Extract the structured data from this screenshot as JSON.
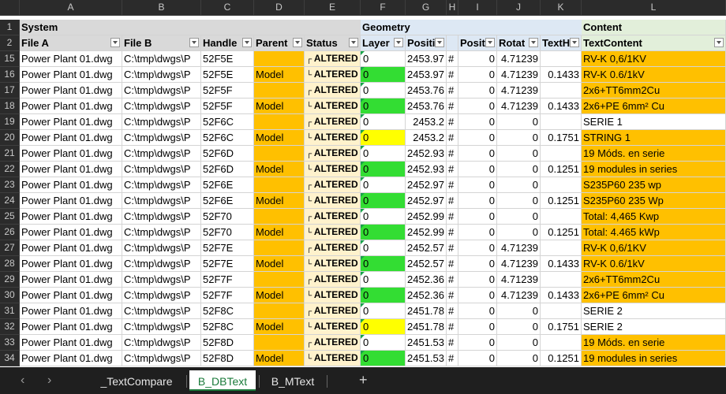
{
  "columns": [
    "A",
    "B",
    "C",
    "D",
    "E",
    "F",
    "G",
    "H",
    "I",
    "J",
    "K",
    "L"
  ],
  "groups": {
    "system": "System",
    "geometry": "Geometry",
    "content": "Content"
  },
  "headers": {
    "file_a": "File A",
    "file_b": "File B",
    "handle": "Handle",
    "parent": "Parent",
    "status": "Status",
    "layer": "Layer",
    "position": "Positi",
    "pos_h": "",
    "pos2": "Posit",
    "rotation": "Rotat",
    "text_height": "TextH",
    "text_content": "TextContent"
  },
  "row_numbers": [
    "1",
    "2"
  ],
  "rows": [
    {
      "n": "15",
      "file_a": "Power Plant 01.dwg",
      "file_b": "C:\\tmp\\dwgs\\P",
      "handle": "52F5E",
      "parent": "",
      "status": "ALTERED",
      "layer": "0",
      "pos": "2453.97",
      "h": "#",
      "pos2": "0",
      "rot": "4.71239",
      "th": "",
      "text": "RV-K 0,6/1KV"
    },
    {
      "n": "16",
      "file_a": "Power Plant 01.dwg",
      "file_b": "C:\\tmp\\dwgs\\P",
      "handle": "52F5E",
      "parent": "Model",
      "status": "ALTERED",
      "layer": "0",
      "pos": "2453.97",
      "h": "#",
      "pos2": "0",
      "rot": "4.71239",
      "th": "0.1433",
      "text": "RV-K 0.6/1kV"
    },
    {
      "n": "17",
      "file_a": "Power Plant 01.dwg",
      "file_b": "C:\\tmp\\dwgs\\P",
      "handle": "52F5F",
      "parent": "",
      "status": "ALTERED",
      "layer": "0",
      "pos": "2453.76",
      "h": "#",
      "pos2": "0",
      "rot": "4.71239",
      "th": "",
      "text": "2x6+TT6mm2Cu"
    },
    {
      "n": "18",
      "file_a": "Power Plant 01.dwg",
      "file_b": "C:\\tmp\\dwgs\\P",
      "handle": "52F5F",
      "parent": "Model",
      "status": "ALTERED",
      "layer": "0",
      "pos": "2453.76",
      "h": "#",
      "pos2": "0",
      "rot": "4.71239",
      "th": "0.1433",
      "text": "2x6+PE 6mm² Cu"
    },
    {
      "n": "19",
      "file_a": "Power Plant 01.dwg",
      "file_b": "C:\\tmp\\dwgs\\P",
      "handle": "52F6C",
      "parent": "",
      "status": "ALTERED",
      "layer": "0",
      "pos": "2453.2",
      "h": "#",
      "pos2": "0",
      "rot": "0",
      "th": "",
      "text": "SERIE 1"
    },
    {
      "n": "20",
      "file_a": "Power Plant 01.dwg",
      "file_b": "C:\\tmp\\dwgs\\P",
      "handle": "52F6C",
      "parent": "Model",
      "status": "ALTERED",
      "layer": "0",
      "pos": "2453.2",
      "h": "#",
      "pos2": "0",
      "rot": "0",
      "th": "0.1751",
      "text": "STRING 1"
    },
    {
      "n": "21",
      "file_a": "Power Plant 01.dwg",
      "file_b": "C:\\tmp\\dwgs\\P",
      "handle": "52F6D",
      "parent": "",
      "status": "ALTERED",
      "layer": "0",
      "pos": "2452.93",
      "h": "#",
      "pos2": "0",
      "rot": "0",
      "th": "",
      "text": "19 Móds. en serie"
    },
    {
      "n": "22",
      "file_a": "Power Plant 01.dwg",
      "file_b": "C:\\tmp\\dwgs\\P",
      "handle": "52F6D",
      "parent": "Model",
      "status": "ALTERED",
      "layer": "0",
      "pos": "2452.93",
      "h": "#",
      "pos2": "0",
      "rot": "0",
      "th": "0.1251",
      "text": "19 modules in series"
    },
    {
      "n": "23",
      "file_a": "Power Plant 01.dwg",
      "file_b": "C:\\tmp\\dwgs\\P",
      "handle": "52F6E",
      "parent": "",
      "status": "ALTERED",
      "layer": "0",
      "pos": "2452.97",
      "h": "#",
      "pos2": "0",
      "rot": "0",
      "th": "",
      "text": "S235P60 235 wp"
    },
    {
      "n": "24",
      "file_a": "Power Plant 01.dwg",
      "file_b": "C:\\tmp\\dwgs\\P",
      "handle": "52F6E",
      "parent": "Model",
      "status": "ALTERED",
      "layer": "0",
      "pos": "2452.97",
      "h": "#",
      "pos2": "0",
      "rot": "0",
      "th": "0.1251",
      "text": "S235P60 235 Wp"
    },
    {
      "n": "25",
      "file_a": "Power Plant 01.dwg",
      "file_b": "C:\\tmp\\dwgs\\P",
      "handle": "52F70",
      "parent": "",
      "status": "ALTERED",
      "layer": "0",
      "pos": "2452.99",
      "h": "#",
      "pos2": "0",
      "rot": "0",
      "th": "",
      "text": "Total: 4,465 Kwp"
    },
    {
      "n": "26",
      "file_a": "Power Plant 01.dwg",
      "file_b": "C:\\tmp\\dwgs\\P",
      "handle": "52F70",
      "parent": "Model",
      "status": "ALTERED",
      "layer": "0",
      "pos": "2452.99",
      "h": "#",
      "pos2": "0",
      "rot": "0",
      "th": "0.1251",
      "text": "Total: 4.465 kWp"
    },
    {
      "n": "27",
      "file_a": "Power Plant 01.dwg",
      "file_b": "C:\\tmp\\dwgs\\P",
      "handle": "52F7E",
      "parent": "",
      "status": "ALTERED",
      "layer": "0",
      "pos": "2452.57",
      "h": "#",
      "pos2": "0",
      "rot": "4.71239",
      "th": "",
      "text": "RV-K 0,6/1KV"
    },
    {
      "n": "28",
      "file_a": "Power Plant 01.dwg",
      "file_b": "C:\\tmp\\dwgs\\P",
      "handle": "52F7E",
      "parent": "Model",
      "status": "ALTERED",
      "layer": "0",
      "pos": "2452.57",
      "h": "#",
      "pos2": "0",
      "rot": "4.71239",
      "th": "0.1433",
      "text": "RV-K 0.6/1kV"
    },
    {
      "n": "29",
      "file_a": "Power Plant 01.dwg",
      "file_b": "C:\\tmp\\dwgs\\P",
      "handle": "52F7F",
      "parent": "",
      "status": "ALTERED",
      "layer": "0",
      "pos": "2452.36",
      "h": "#",
      "pos2": "0",
      "rot": "4.71239",
      "th": "",
      "text": "2x6+TT6mm2Cu"
    },
    {
      "n": "30",
      "file_a": "Power Plant 01.dwg",
      "file_b": "C:\\tmp\\dwgs\\P",
      "handle": "52F7F",
      "parent": "Model",
      "status": "ALTERED",
      "layer": "0",
      "pos": "2452.36",
      "h": "#",
      "pos2": "0",
      "rot": "4.71239",
      "th": "0.1433",
      "text": "2x6+PE 6mm² Cu"
    },
    {
      "n": "31",
      "file_a": "Power Plant 01.dwg",
      "file_b": "C:\\tmp\\dwgs\\P",
      "handle": "52F8C",
      "parent": "",
      "status": "ALTERED",
      "layer": "0",
      "pos": "2451.78",
      "h": "#",
      "pos2": "0",
      "rot": "0",
      "th": "",
      "text": "SERIE 2"
    },
    {
      "n": "32",
      "file_a": "Power Plant 01.dwg",
      "file_b": "C:\\tmp\\dwgs\\P",
      "handle": "52F8C",
      "parent": "Model",
      "status": "ALTERED",
      "layer": "0",
      "pos": "2451.78",
      "h": "#",
      "pos2": "0",
      "rot": "0",
      "th": "0.1751",
      "text": "SERIE 2"
    },
    {
      "n": "33",
      "file_a": "Power Plant 01.dwg",
      "file_b": "C:\\tmp\\dwgs\\P",
      "handle": "52F8D",
      "parent": "",
      "status": "ALTERED",
      "layer": "0",
      "pos": "2451.53",
      "h": "#",
      "pos2": "0",
      "rot": "0",
      "th": "",
      "text": "19 Móds. en serie"
    },
    {
      "n": "34",
      "file_a": "Power Plant 01.dwg",
      "file_b": "C:\\tmp\\dwgs\\P",
      "handle": "52F8D",
      "parent": "Model",
      "status": "ALTERED",
      "layer": "0",
      "pos": "2451.53",
      "h": "#",
      "pos2": "0",
      "rot": "0",
      "th": "0.1251",
      "text": "19 modules in series"
    }
  ],
  "layer_fill": [
    "white",
    "green",
    "white",
    "green",
    "white",
    "yellow",
    "white",
    "green",
    "white",
    "green",
    "white",
    "green",
    "white",
    "green",
    "white",
    "green",
    "white",
    "yellow",
    "white",
    "green"
  ],
  "text_fill": [
    "orange",
    "orange",
    "orange",
    "orange",
    "white",
    "orange",
    "orange",
    "orange",
    "orange",
    "orange",
    "orange",
    "orange",
    "orange",
    "orange",
    "orange",
    "orange",
    "white",
    "white",
    "orange",
    "orange"
  ],
  "colors": {
    "system_group": "#d9d9d9",
    "geometry_group": "#dde8f4",
    "content_group": "#e2efda",
    "parent_fill": "#ffc000",
    "status_fill": "#fff2cc",
    "orange": "#ffc000",
    "green": "#33dd33",
    "yellow": "#ffff00",
    "row_alt": "#d8d8d8"
  },
  "tabs": [
    {
      "label": "_TextCompare",
      "active": false
    },
    {
      "label": "B_DBText",
      "active": true
    },
    {
      "label": "B_MText",
      "active": false
    }
  ],
  "tabbar": {
    "prev": "‹",
    "next": "›",
    "add": "+"
  }
}
